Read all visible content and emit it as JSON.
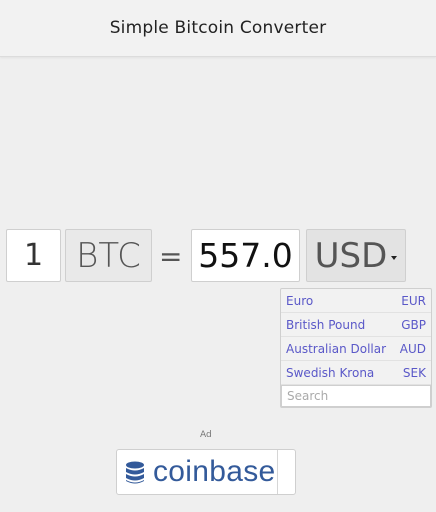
{
  "header": {
    "title": "Simple Bitcoin Converter"
  },
  "converter": {
    "amount": "1",
    "from_currency": "BTC",
    "equals": "=",
    "result": "557.0",
    "to_currency": "USD"
  },
  "dropdown": {
    "options": [
      {
        "name": "Euro",
        "code": "EUR"
      },
      {
        "name": "British Pound",
        "code": "GBP"
      },
      {
        "name": "Australian Dollar",
        "code": "AUD"
      },
      {
        "name": "Swedish Krona",
        "code": "SEK"
      }
    ],
    "search_placeholder": "Search"
  },
  "ad": {
    "label": "Ad",
    "brand": "coinbase",
    "icon": "database-stack-icon"
  },
  "colors": {
    "link": "#5a58c8",
    "brand": "#335a9a"
  }
}
